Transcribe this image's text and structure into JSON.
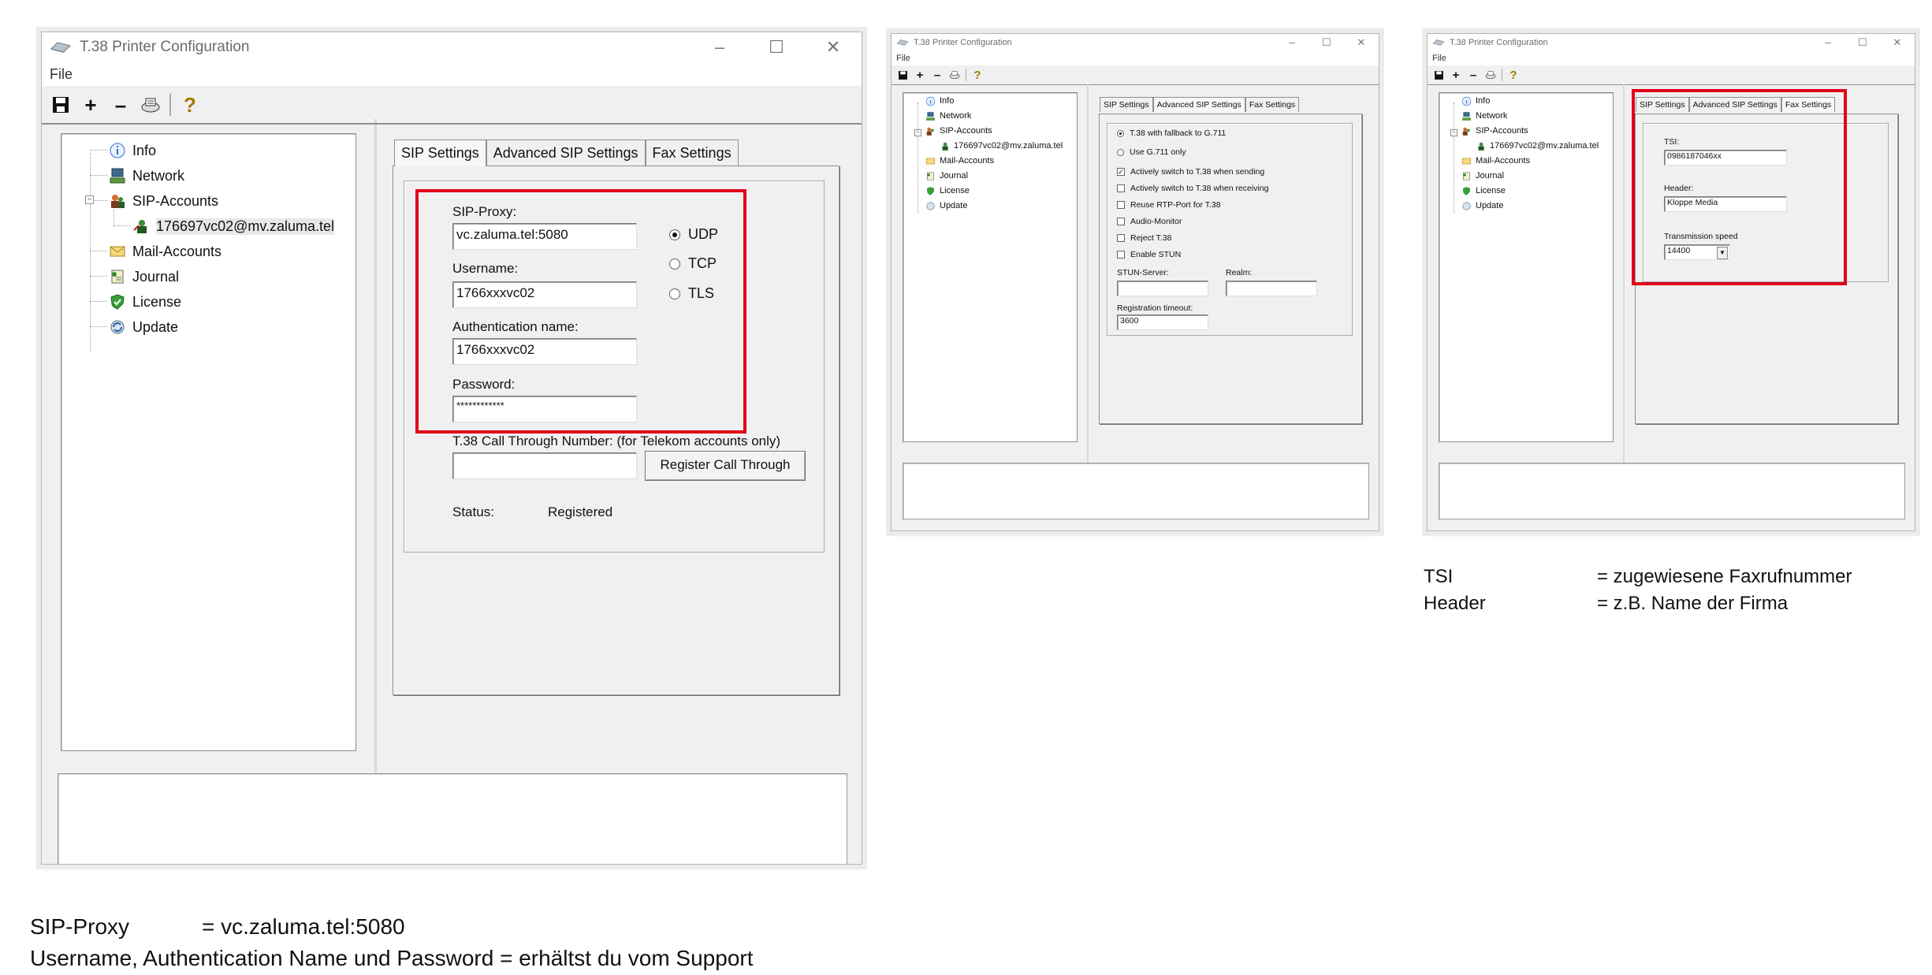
{
  "windows": {
    "main": {
      "title": "T.38 Printer Configuration",
      "menu_file": "File",
      "tree": {
        "info": "Info",
        "network": "Network",
        "sip_accounts": "SIP-Accounts",
        "account": "176697vc02@mv.zaluma.tel",
        "mail_accounts": "Mail-Accounts",
        "journal": "Journal",
        "license": "License",
        "update": "Update"
      },
      "tabs": {
        "sip_settings": "SIP Settings",
        "advanced_sip_settings": "Advanced SIP Settings",
        "fax_settings": "Fax Settings"
      }
    }
  },
  "sip_settings": {
    "sip_proxy_label": "SIP-Proxy:",
    "sip_proxy_value": "vc.zaluma.tel:5080",
    "username_label": "Username:",
    "username_value": "1766xxxvc02",
    "auth_name_label": "Authentication name:",
    "auth_name_value": "1766xxxvc02",
    "password_label": "Password:",
    "password_value": "************",
    "transport_udp": "UDP",
    "transport_tcp": "TCP",
    "transport_tls": "TLS",
    "transport_selected": "UDP",
    "call_through_label": "T.38 Call Through Number: (for Telekom accounts only)",
    "call_through_value": "",
    "register_button": "Register Call Through",
    "status_label": "Status:",
    "status_value": "Registered"
  },
  "advanced_sip_settings": {
    "t38_fallback": "T.38 with fallback to G.711",
    "g711_only": "Use G.711 only",
    "mode_selected": "T.38 with fallback to G.711",
    "switch_sending": "Actively switch to T.38 when sending",
    "switch_sending_checked": true,
    "switch_receiving": "Actively switch to T.38 when receiving",
    "switch_receiving_checked": false,
    "reuse_rtp": "Reuse RTP-Port for T.38",
    "reuse_rtp_checked": false,
    "audio_monitor": "Audio-Monitor",
    "audio_monitor_checked": false,
    "reject_t38": "Reject T.38",
    "reject_t38_checked": false,
    "enable_stun": "Enable STUN",
    "enable_stun_checked": false,
    "stun_server_label": "STUN-Server:",
    "stun_server_value": "",
    "realm_label": "Realm:",
    "realm_value": "",
    "reg_timeout_label": "Registration timeout:",
    "reg_timeout_value": "3600"
  },
  "fax_settings": {
    "tsi_label": "TSI:",
    "tsi_value": "0986187046xx",
    "header_label": "Header:",
    "header_value": "Kloppe Media",
    "speed_label": "Transmission speed",
    "speed_value": "14400"
  },
  "captions": {
    "sip_proxy_term": "SIP-Proxy",
    "sip_proxy_def": "= vc.zaluma.tel:5080",
    "credentials_line": "Username, Authentication Name und Password = erhältst du vom Support",
    "tsi_term": "TSI",
    "tsi_def": "= zugewiesene Faxrufnummer",
    "header_term": "Header",
    "header_def": "= z.B. Name der Firma"
  },
  "icons": {
    "app": "printer-icon",
    "save": "save-icon",
    "add": "plus-icon",
    "remove": "minus-icon",
    "test": "fax-icon",
    "help": "help-icon"
  },
  "colors": {
    "highlight": "#e2001a",
    "window_bg": "#f0f0f0",
    "panel_bg": "#ffffff"
  }
}
